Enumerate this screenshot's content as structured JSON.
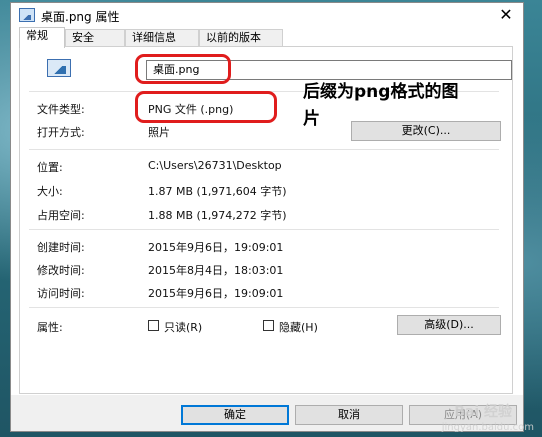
{
  "window": {
    "title": "桌面.png 属性",
    "close_glyph": "✕"
  },
  "tabs": [
    {
      "label": "常规",
      "active": true
    },
    {
      "label": "安全",
      "active": false
    },
    {
      "label": "详细信息",
      "active": false
    },
    {
      "label": "以前的版本",
      "active": false
    }
  ],
  "general": {
    "filename": "桌面.png",
    "file_type_label": "文件类型:",
    "file_type_value": "PNG 文件 (.png)",
    "open_with_label": "打开方式:",
    "open_with_value": "照片",
    "change_button": "更改(C)...",
    "location_label": "位置:",
    "location_value": "C:\\Users\\26731\\Desktop",
    "size_label": "大小:",
    "size_value": "1.87 MB (1,971,604 字节)",
    "size_on_disk_label": "占用空间:",
    "size_on_disk_value": "1.88 MB (1,974,272 字节)",
    "created_label": "创建时间:",
    "created_value": "2015年9月6日，19:09:01",
    "modified_label": "修改时间:",
    "modified_value": "2015年8月4日，18:03:01",
    "accessed_label": "访问时间:",
    "accessed_value": "2015年9月6日，19:09:01",
    "attributes_label": "属性:",
    "readonly_label": "只读(R)",
    "hidden_label": "隐藏(H)",
    "advanced_button": "高级(D)..."
  },
  "footer": {
    "ok_button": "确定",
    "cancel_button": "取消",
    "apply_button": "应用(A)"
  },
  "annotation": {
    "line1": "后缀为png格式的图",
    "line2": "片",
    "color": "#e01d1d"
  },
  "watermark": {
    "logo": "Bai 经验",
    "url": "jingyan.baidu.com"
  }
}
